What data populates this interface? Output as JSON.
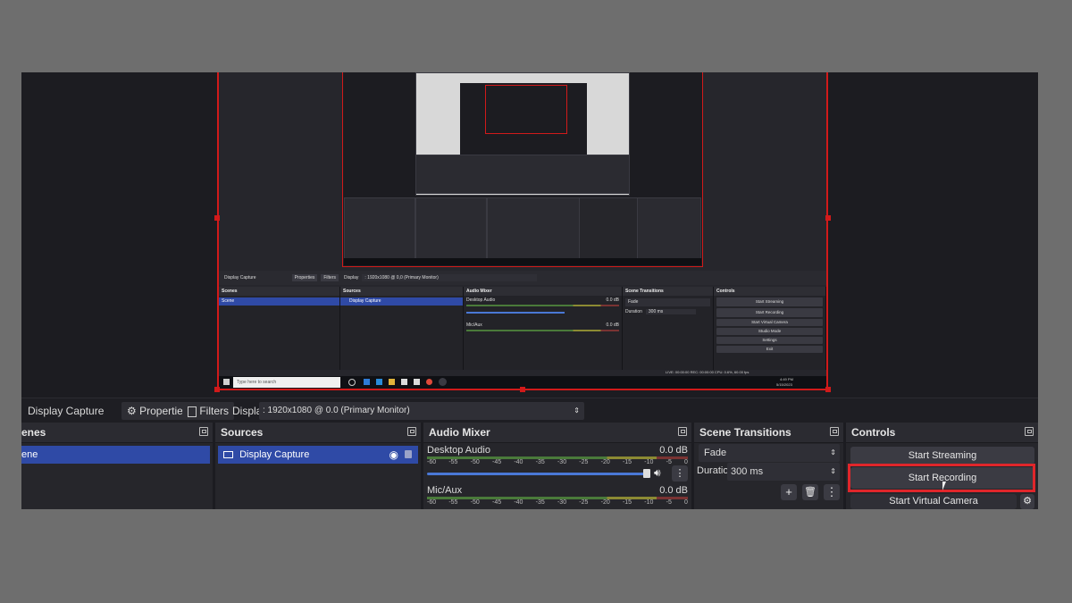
{
  "preview": {
    "inner_toolbar": {
      "source_name": "Display Capture",
      "properties": "Properties",
      "filters": "Filters",
      "display_label": "Display",
      "display_value": ": 1920x1080 @ 0,0 (Primary Monitor)"
    },
    "inner_docks": {
      "scenes": {
        "title": "Scenes",
        "item": "Scene"
      },
      "sources": {
        "title": "Sources",
        "item": "Display Capture"
      },
      "mixer": {
        "title": "Audio Mixer",
        "ch1": "Desktop Audio",
        "ch1_db": "0.0 dB",
        "ch2": "Mic/Aux",
        "ch2_db": "0.0 dB"
      },
      "transitions": {
        "title": "Scene Transitions",
        "fade": "Fade",
        "duration_label": "Duration",
        "duration_value": "300 ms"
      },
      "controls": {
        "title": "Controls",
        "buttons": [
          "Start Streaming",
          "Start Recording",
          "Start Virtual Camera",
          "Studio Mode",
          "Settings",
          "Exit"
        ]
      }
    },
    "inner_status": "LIVE: 00:00:00   REC: 00:00:00   CPU: 0.6%, 60.00 fps",
    "taskbar": {
      "search_placeholder": "Type here to search",
      "time": "4:49 PM",
      "date": "5/15/2023"
    }
  },
  "toolbar": {
    "source_name": "Display Capture",
    "properties_label": "Properties",
    "filters_label": "Filters",
    "display_label": "Display",
    "display_value": ": 1920x1080 @ 0.0 (Primary Monitor)"
  },
  "scenes": {
    "title": "enes",
    "item": "ene"
  },
  "sources": {
    "title": "Sources",
    "item": "Display Capture"
  },
  "mixer": {
    "title": "Audio Mixer",
    "ch1": {
      "name": "Desktop Audio",
      "db": "0.0 dB"
    },
    "ch2": {
      "name": "Mic/Aux",
      "db": "0.0 dB"
    },
    "scale": [
      "-60",
      "-55",
      "-50",
      "-45",
      "-40",
      "-35",
      "-30",
      "-25",
      "-20",
      "-15",
      "-10",
      "-5",
      "0"
    ]
  },
  "transitions": {
    "title": "Scene Transitions",
    "fade": "Fade",
    "duration_label": "Duration",
    "duration_value": "300 ms"
  },
  "controls": {
    "title": "Controls",
    "start_streaming": "Start Streaming",
    "start_recording": "Start Recording",
    "start_virtual_camera": "Start Virtual Camera"
  },
  "colors": {
    "highlight": "#e0262b",
    "selection": "#2f4aa6",
    "meter_green": "#4a7a3a",
    "meter_yellow": "#8c8a33"
  }
}
